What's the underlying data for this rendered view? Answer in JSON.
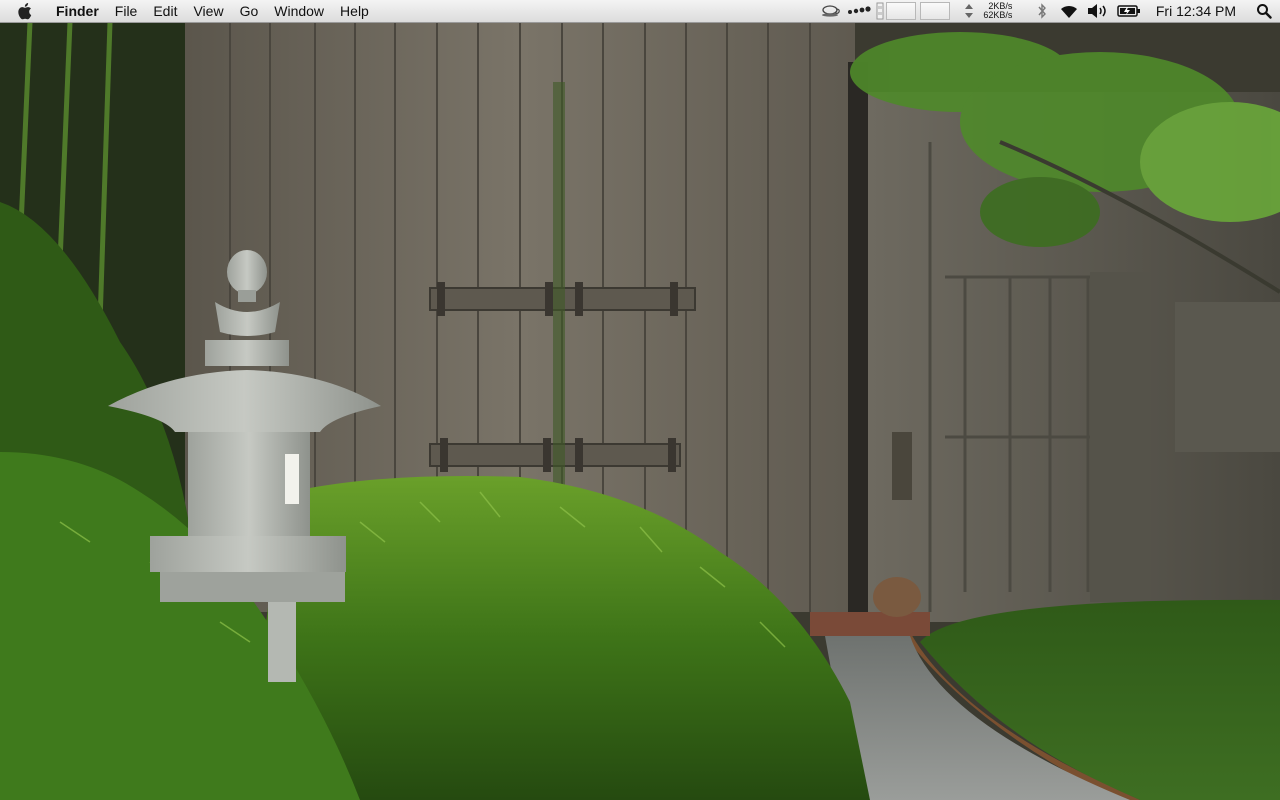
{
  "menubar": {
    "app_name": "Finder",
    "menus": [
      "File",
      "Edit",
      "View",
      "Go",
      "Window",
      "Help"
    ],
    "network_up": "2KB/s",
    "network_down": "62KB/s",
    "clock": "Fri 12:34 PM"
  },
  "icons": [
    "apple-icon",
    "coffee-cup-icon",
    "dots-icon",
    "disk-meter-icon",
    "cpu-meter-icon",
    "memory-meter-icon",
    "network-arrows-icon",
    "bluetooth-icon",
    "wifi-icon",
    "volume-icon",
    "battery-icon",
    "spotlight-icon"
  ],
  "wallpaper": {
    "description_colors": {
      "wood": "#6f6a5f",
      "foliage": "#3f6a1a",
      "stone": "#b9bcb6",
      "path": "#8a8d8a"
    }
  }
}
